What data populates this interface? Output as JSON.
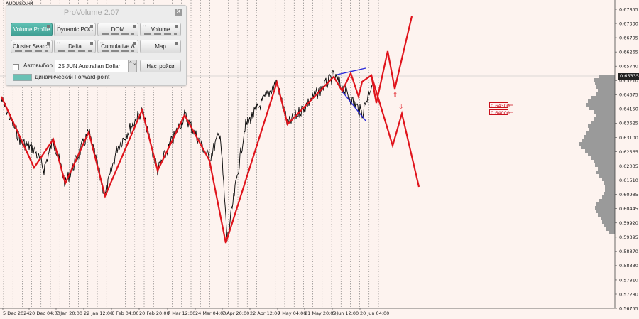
{
  "window": {
    "symbol_title": "AUDUSD,H4"
  },
  "panel": {
    "title": "ProVolume 2.07",
    "close_glyph": "✕",
    "buttons": {
      "volume_profile": "Volume Profile",
      "dynamic_poc": "Dynamic POC",
      "dom": "DOM",
      "volume": "Volume",
      "cluster_search": "Cluster Search",
      "delta": "Delta",
      "cumulative_delta": "Cumulative Δ",
      "map": "Map",
      "settings": "Настройки"
    },
    "auto_select_label": "Автовыбор",
    "instrument_value": "25 JUN Australian Dollar",
    "select_arrows": "⌃⌄",
    "forward_point_label": "Динамический Forward-point"
  },
  "price_axis": [
    "0.67855",
    "0.67330",
    "0.66795",
    "0.66265",
    "0.65740",
    "0.65210",
    "0.64675",
    "0.64150",
    "0.63625",
    "0.63100",
    "0.62565",
    "0.62035",
    "0.61510",
    "0.60985",
    "0.60445",
    "0.59920",
    "0.59395",
    "0.58870",
    "0.58330",
    "0.57810",
    "0.57280",
    "0.56755"
  ],
  "current_price": "0.65335",
  "levels": [
    "0.64300",
    "0.64000"
  ],
  "time_axis": [
    "5 Dec 2024",
    "20 Dec 04:00",
    "7 Jan 20:00",
    "22 Jan 12:00",
    "6 Feb 04:00",
    "20 Feb 20:00",
    "7 Mar 12:00",
    "24 Mar 04:00",
    "7 Apr 20:00",
    "22 Apr 12:00",
    "7 May 04:00",
    "21 May 20:00",
    "5 Jun 12:00",
    "20 Jun 04:00"
  ],
  "colors": {
    "background": "#fdf3ef",
    "candles": "#000000",
    "zigzag": "#e0141c",
    "wedge": "#2a2ad8",
    "profile": "#9a9a9a",
    "panel_accent": "#4fb0a4"
  },
  "chart_data": {
    "type": "line",
    "series": [
      {
        "x": [
          "5 Dec 2024",
          "20 Dec 04:00",
          "7 Jan 20:00",
          "22 Jan 12:00",
          "6 Feb 04:00",
          "20 Feb 20:00",
          "7 Mar 12:00",
          "24 Mar 04:00",
          "7 Apr 20:00",
          "22 Apr 12:00",
          "7 May 04:00",
          "21 May 20:00",
          "5 Jun 12:00",
          "20 Jun 04:00"
        ],
        "y": [
          0.644,
          0.623,
          0.625,
          0.616,
          0.63,
          0.635,
          0.638,
          0.63,
          0.595,
          0.633,
          0.642,
          0.644,
          0.65,
          0.648
        ]
      }
    ],
    "ylim": [
      0.5675,
      0.6786
    ],
    "grid": true
  }
}
